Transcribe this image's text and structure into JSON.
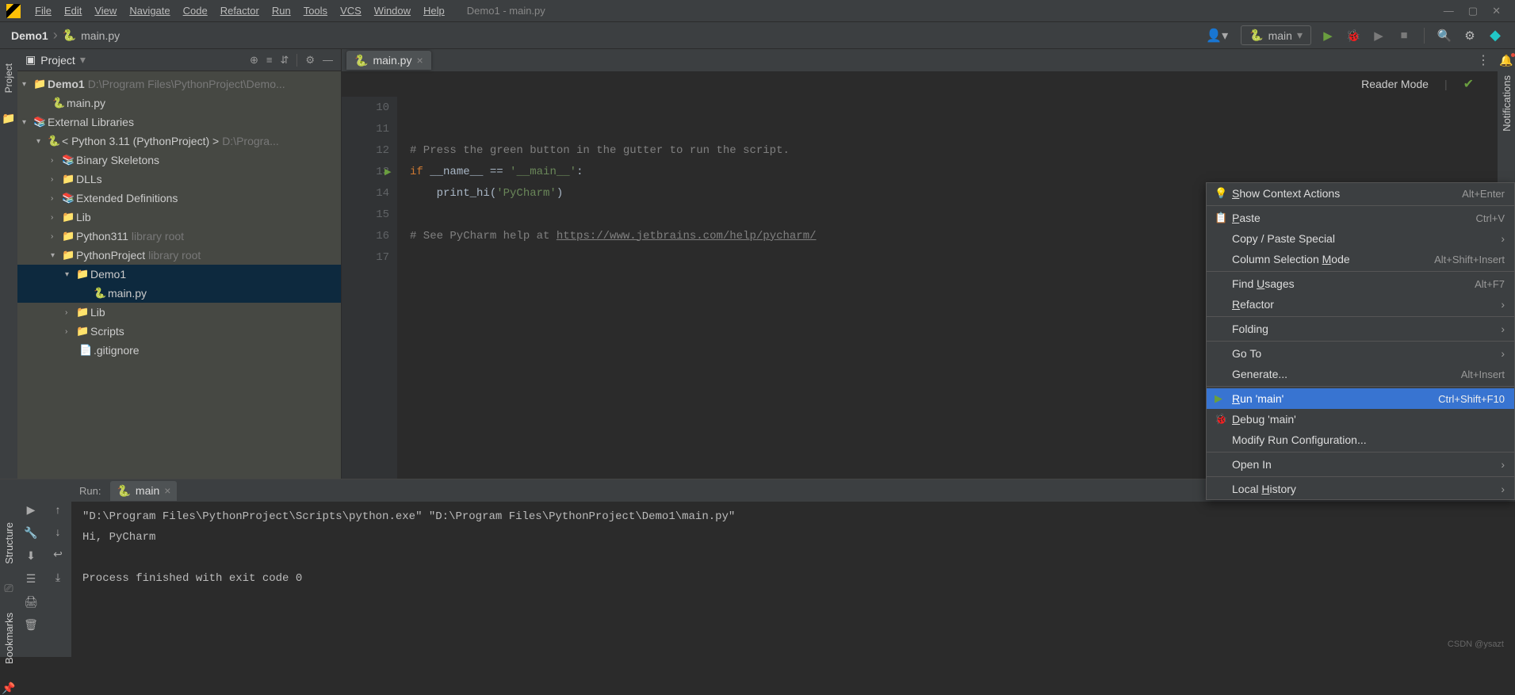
{
  "menubar": {
    "items": [
      "File",
      "Edit",
      "View",
      "Navigate",
      "Code",
      "Refactor",
      "Run",
      "Tools",
      "VCS",
      "Window",
      "Help"
    ],
    "title": "Demo1 - main.py"
  },
  "breadcrumb": {
    "project": "Demo1",
    "file": "main.py"
  },
  "toolbar": {
    "run_config": "main"
  },
  "project_pane": {
    "title": "Project",
    "root": {
      "name": "Demo1",
      "path": "D:\\Program Files\\PythonProject\\Demo..."
    },
    "root_file": "main.py",
    "ext_libs": "External Libraries",
    "python": {
      "label": "< Python 3.11 (PythonProject) >",
      "path": "D:\\Progra..."
    },
    "items": [
      "Binary Skeletons",
      "DLLs",
      "Extended Definitions",
      "Lib",
      "Python311",
      "PythonProject",
      "Demo1",
      "main.py",
      "Lib",
      "Scripts",
      ".gitignore"
    ],
    "library_root": "library root"
  },
  "editor": {
    "tab": "main.py",
    "reader_mode": "Reader Mode",
    "gutter": [
      "10",
      "11",
      "12",
      "13",
      "14",
      "15",
      "16",
      "17"
    ],
    "code": {
      "l12": "# Press the green button in the gutter to run the script.",
      "l13_if": "if",
      "l13_name": " __name__ ",
      "l13_eq": "==",
      "l13_str": " '__main__'",
      "l13_colon": ":",
      "l14_indent": "    print_hi(",
      "l14_str": "'PyCharm'",
      "l14_close": ")",
      "l16_pre": "# See PyCharm help at ",
      "l16_url": "https://www.jetbrains.com/help/pycharm/"
    }
  },
  "run": {
    "label": "Run:",
    "tab": "main",
    "output_line1": "\"D:\\Program Files\\PythonProject\\Scripts\\python.exe\" \"D:\\Program Files\\PythonProject\\Demo1\\main.py\"",
    "output_line2": "Hi, PyCharm",
    "output_line3": "",
    "output_line4": "Process finished with exit code 0"
  },
  "sidebar_rails": {
    "project": "Project",
    "structure": "Structure",
    "bookmarks": "Bookmarks",
    "notifications": "Notifications"
  },
  "context_menu": [
    {
      "icon": "bulb",
      "label": "Show Context Actions",
      "shortcut": "Alt+Enter",
      "ul": 0
    },
    {
      "sep": true
    },
    {
      "icon": "paste",
      "label": "Paste",
      "shortcut": "Ctrl+V",
      "ul": 0
    },
    {
      "label": "Copy / Paste Special",
      "sub": true
    },
    {
      "label": "Column Selection Mode",
      "shortcut": "Alt+Shift+Insert",
      "ul": 17
    },
    {
      "sep": true
    },
    {
      "label": "Find Usages",
      "shortcut": "Alt+F7",
      "ul": 5
    },
    {
      "label": "Refactor",
      "sub": true,
      "ul": 0
    },
    {
      "sep": true
    },
    {
      "label": "Folding",
      "sub": true
    },
    {
      "sep": true
    },
    {
      "label": "Go To",
      "sub": true
    },
    {
      "label": "Generate...",
      "shortcut": "Alt+Insert"
    },
    {
      "sep": true
    },
    {
      "icon": "run",
      "label": "Run 'main'",
      "shortcut": "Ctrl+Shift+F10",
      "selected": true,
      "ul": 0
    },
    {
      "icon": "bug",
      "label": "Debug 'main'",
      "ul": 0
    },
    {
      "label": "Modify Run Configuration..."
    },
    {
      "sep": true
    },
    {
      "label": "Open In",
      "sub": true
    },
    {
      "sep": true
    },
    {
      "label": "Local History",
      "sub": true,
      "ul": 6
    }
  ],
  "watermark": "CSDN @ysazt"
}
